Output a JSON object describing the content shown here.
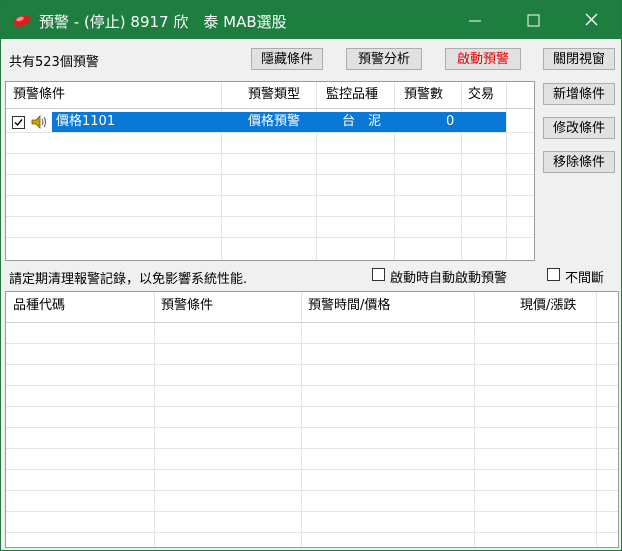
{
  "window": {
    "title": "預警 - (停止) 8917 欣　泰 MAB選股",
    "controls": {
      "minimize": "minimize-icon",
      "maximize": "maximize-icon",
      "close": "close-icon"
    }
  },
  "toolbar": {
    "count_label": "共有523個預警",
    "hide_conditions": "隱藏條件",
    "alert_analysis": "預警分析",
    "start_alert": "啟動預警",
    "close_window": "關閉視窗"
  },
  "side_buttons": {
    "add": "新增條件",
    "edit": "修改條件",
    "remove": "移除條件"
  },
  "alert_table": {
    "columns": [
      "預警條件",
      "預警類型",
      "監控品種",
      "預警數",
      "交易"
    ],
    "rows": [
      {
        "checked": true,
        "icon": "speaker-icon",
        "condition": "價格1101",
        "type": "價格預警",
        "instrument": "台　泥",
        "count": "0",
        "trade": ""
      }
    ]
  },
  "options": {
    "note": "請定期清理報警記錄，以免影響系統性能.",
    "auto_start": "啟動時自動啟動預警",
    "no_interrupt": "不間斷"
  },
  "log_table": {
    "columns": [
      "品種代碼",
      "預警條件",
      "預警時間/價格",
      "現價/漲跌"
    ]
  },
  "colors": {
    "titlebar": "#1d7e3f",
    "selection": "#0a78d7",
    "alert_text": "#e00000"
  }
}
